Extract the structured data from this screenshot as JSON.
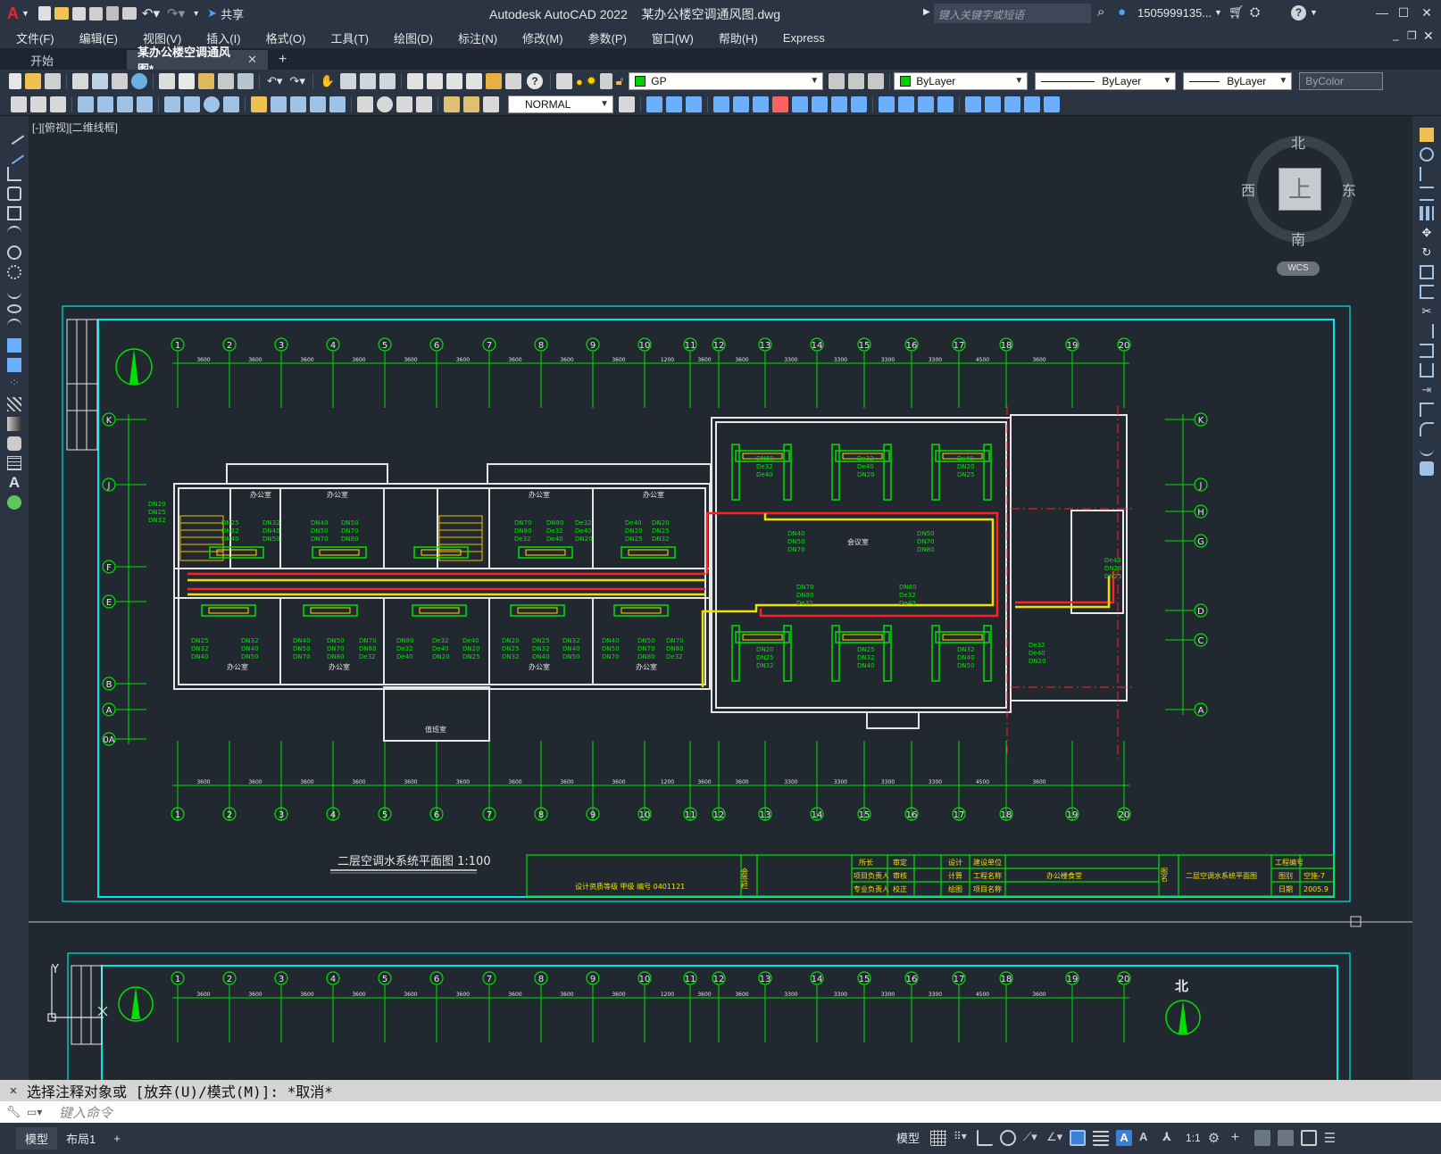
{
  "app": {
    "logo": "A",
    "share_label": "共享",
    "title": "Autodesk AutoCAD 2022",
    "filename": "某办公楼空调通风图.dwg",
    "search_placeholder": "键入关键字或短语",
    "user": "1505999135...",
    "help": "?"
  },
  "menu": [
    "文件(F)",
    "编辑(E)",
    "视图(V)",
    "插入(I)",
    "格式(O)",
    "工具(T)",
    "绘图(D)",
    "标注(N)",
    "修改(M)",
    "参数(P)",
    "窗口(W)",
    "帮助(H)",
    "Express"
  ],
  "tabs": [
    {
      "label": "开始"
    },
    {
      "label": "某办公楼空调通风图*"
    }
  ],
  "toolbar": {
    "layer_name": "GP",
    "color": "ByLayer",
    "linetype": "ByLayer",
    "lineweight": "ByLayer",
    "plotstyle": "ByColor",
    "dimstyle": "NORMAL"
  },
  "viewport_label": "[-][俯视][二维线框]",
  "viewcube": {
    "north": "北",
    "south": "南",
    "east": "东",
    "west": "西",
    "face": "上",
    "wcs": "WCS"
  },
  "drawing": {
    "axis_numbers": [
      "1",
      "2",
      "3",
      "4",
      "5",
      "6",
      "7",
      "8",
      "9",
      "10",
      "11",
      "12",
      "13",
      "14",
      "15",
      "16",
      "17",
      "18",
      "19",
      "20"
    ],
    "axis_letters_left": [
      "K",
      "J",
      "F",
      "E",
      "B",
      "A",
      "0A"
    ],
    "axis_letters_right": [
      "K",
      "J",
      "H",
      "G",
      "D",
      "C",
      "A"
    ],
    "bay_dims": [
      "3600",
      "3600",
      "3600",
      "3600",
      "3600",
      "3600",
      "3600",
      "3600",
      "3600",
      "1200",
      "3600",
      "3600",
      "3300",
      "3300",
      "3300",
      "3300",
      "4500",
      "3600"
    ],
    "room_office": "办公室",
    "room_meeting": "会议室",
    "room_duty": "值班室",
    "pipe_labels": [
      "DN20",
      "DN25",
      "DN32",
      "DN40",
      "DN50",
      "DN70",
      "DN80",
      "De32",
      "De40"
    ],
    "title": "二层空调水系统平面图  1:100",
    "title_block": {
      "cert": "设计资质等级  甲级    编号  0401121",
      "sign": "会签栏",
      "r1": [
        "所长",
        "审定",
        "设计"
      ],
      "r2": [
        "项目负责人",
        "审核",
        "计算"
      ],
      "r3": [
        "专业负责人",
        "校正",
        "绘图"
      ],
      "l1": "建设单位",
      "l2": "工程名称",
      "l2v": "办公楼食堂",
      "l3": "项目名称",
      "drawing_name_label": "图名",
      "drawing_name": "二层空调水系统平面图",
      "k1": "工程编号",
      "k2": "图别",
      "k2v": "空施-7",
      "k3": "日期",
      "k3v": "2005.9"
    },
    "north_label": "北",
    "ucs_y": "Y"
  },
  "command": {
    "history": "选择注释对象或 [放弃(U)/模式(M)]: *取消*",
    "placeholder": "键入命令"
  },
  "status": {
    "model_tab": "模型",
    "layout_tab": "布局1",
    "model_btn": "模型",
    "scale": "1:1"
  }
}
